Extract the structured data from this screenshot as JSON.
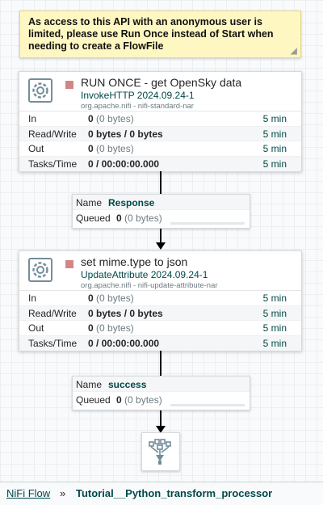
{
  "note": {
    "text": "As access to this API with an anonymous user is limited, please use Run Once instead of Start when needing to create a FlowFile"
  },
  "processors": [
    {
      "name": "RUN ONCE - get OpenSky data",
      "type": "InvokeHTTP 2024.09.24-1",
      "bundle": "org.apache.nifi - nifi-standard-nar",
      "stats": [
        {
          "label": "In",
          "value": "0",
          "detail": "(0 bytes)",
          "time": "5 min"
        },
        {
          "label": "Read/Write",
          "value": "0 bytes / 0 bytes",
          "detail": "",
          "time": "5 min"
        },
        {
          "label": "Out",
          "value": "0",
          "detail": "(0 bytes)",
          "time": "5 min"
        },
        {
          "label": "Tasks/Time",
          "value": "0 / 00:00:00.000",
          "detail": "",
          "time": "5 min"
        }
      ]
    },
    {
      "name": "set mime.type to json",
      "type": "UpdateAttribute 2024.09.24-1",
      "bundle": "org.apache.nifi - nifi-update-attribute-nar",
      "stats": [
        {
          "label": "In",
          "value": "0",
          "detail": "(0 bytes)",
          "time": "5 min"
        },
        {
          "label": "Read/Write",
          "value": "0 bytes / 0 bytes",
          "detail": "",
          "time": "5 min"
        },
        {
          "label": "Out",
          "value": "0",
          "detail": "(0 bytes)",
          "time": "5 min"
        },
        {
          "label": "Tasks/Time",
          "value": "0 / 00:00:00.000",
          "detail": "",
          "time": "5 min"
        }
      ]
    }
  ],
  "connections": [
    {
      "name_label": "Name",
      "name": "Response",
      "queued_label": "Queued",
      "queued_count": "0",
      "queued_size": "(0 bytes)"
    },
    {
      "name_label": "Name",
      "name": "success",
      "queued_label": "Queued",
      "queued_count": "0",
      "queued_size": "(0 bytes)"
    }
  ],
  "breadcrumb": {
    "root": "NiFi Flow",
    "separator": "»",
    "current": "Tutorial__Python_transform_processor"
  },
  "icons": {
    "processor": "processor-gear-icon",
    "stopped": "stopped-square-icon",
    "funnel": "funnel-icon"
  },
  "colors": {
    "accent": "#004849",
    "stopped": "#d18686",
    "note_bg": "#fff7c2"
  }
}
